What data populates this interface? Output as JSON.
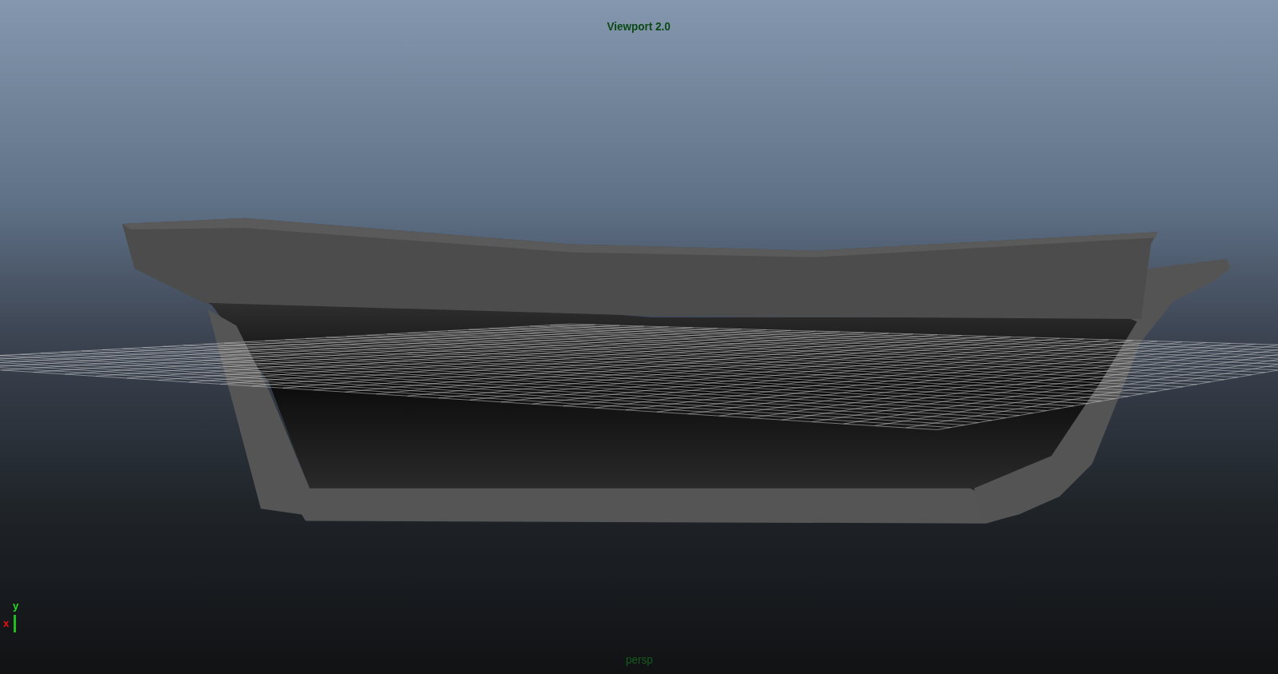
{
  "viewport": {
    "title": "Viewport 2.0",
    "camera": "persp"
  },
  "axis_gizmo": {
    "labels": [
      "y",
      "x"
    ]
  }
}
